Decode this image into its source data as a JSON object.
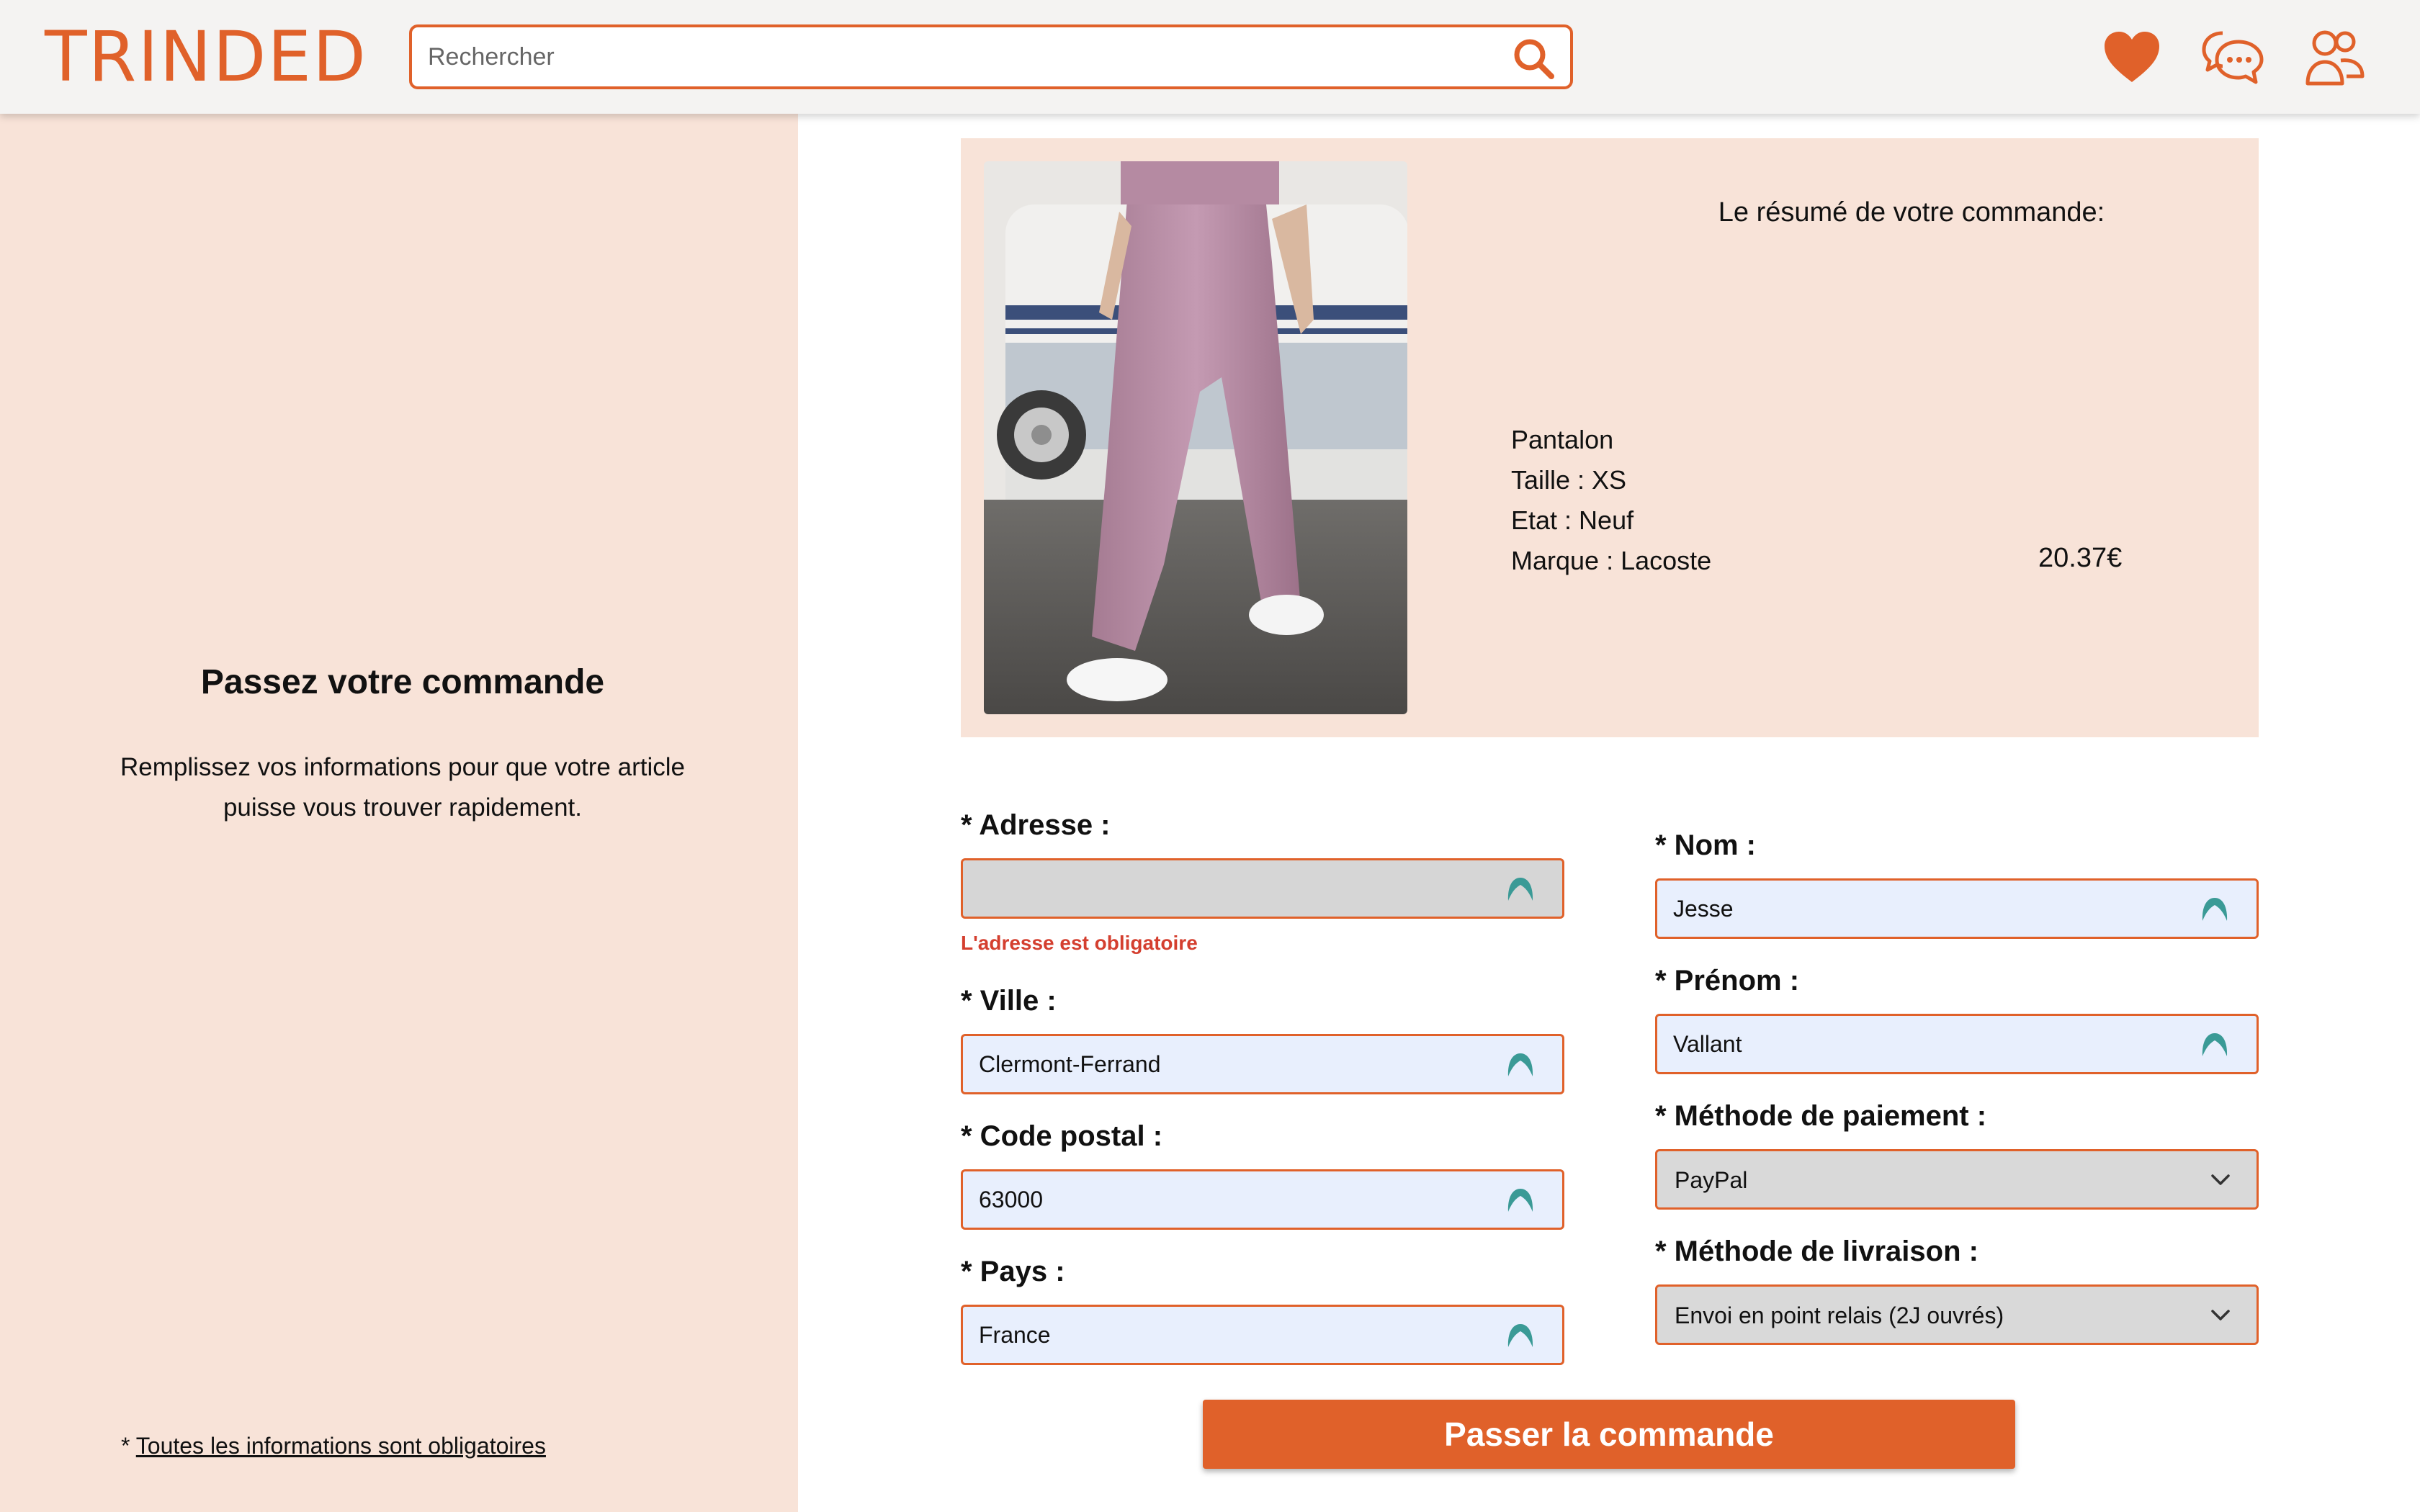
{
  "header": {
    "logo": "TRINDED",
    "search_placeholder": "Rechercher",
    "icons": [
      "search-icon",
      "heart-icon",
      "chat-icon",
      "users-icon"
    ]
  },
  "colors": {
    "accent": "#e0612a",
    "panel": "#f8e3d8",
    "field_fill": "#e8effd",
    "error": "#d43f2f"
  },
  "sidebar": {
    "title": "Passez votre commande",
    "subtitle": "Remplissez vos informations pour que votre article puisse vous trouver rapidement.",
    "note_prefix": "* ",
    "note_link": "Toutes les informations sont obligatoires"
  },
  "summary": {
    "title": "Le résumé de votre commande:",
    "item": "Pantalon",
    "size": "Taille : XS",
    "state": "Etat : Neuf",
    "brand": "Marque : Lacoste",
    "price": "20.37€"
  },
  "form": {
    "address": {
      "label": "* Adresse :",
      "value": "",
      "error": "L'adresse est obligatoire"
    },
    "city": {
      "label": "* Ville :",
      "value": "Clermont-Ferrand"
    },
    "postal": {
      "label": "* Code postal :",
      "value": "63000"
    },
    "country": {
      "label": "* Pays :",
      "value": "France"
    },
    "last_name": {
      "label": "* Nom :",
      "value": "Jesse"
    },
    "first_name": {
      "label": "* Prénom :",
      "value": "Vallant"
    },
    "payment": {
      "label": "* Méthode de paiement :",
      "value": "PayPal"
    },
    "shipping": {
      "label": "* Méthode de livraison :",
      "value": "Envoi en point relais (2J ouvrés)"
    },
    "submit_label": "Passer la commande"
  }
}
